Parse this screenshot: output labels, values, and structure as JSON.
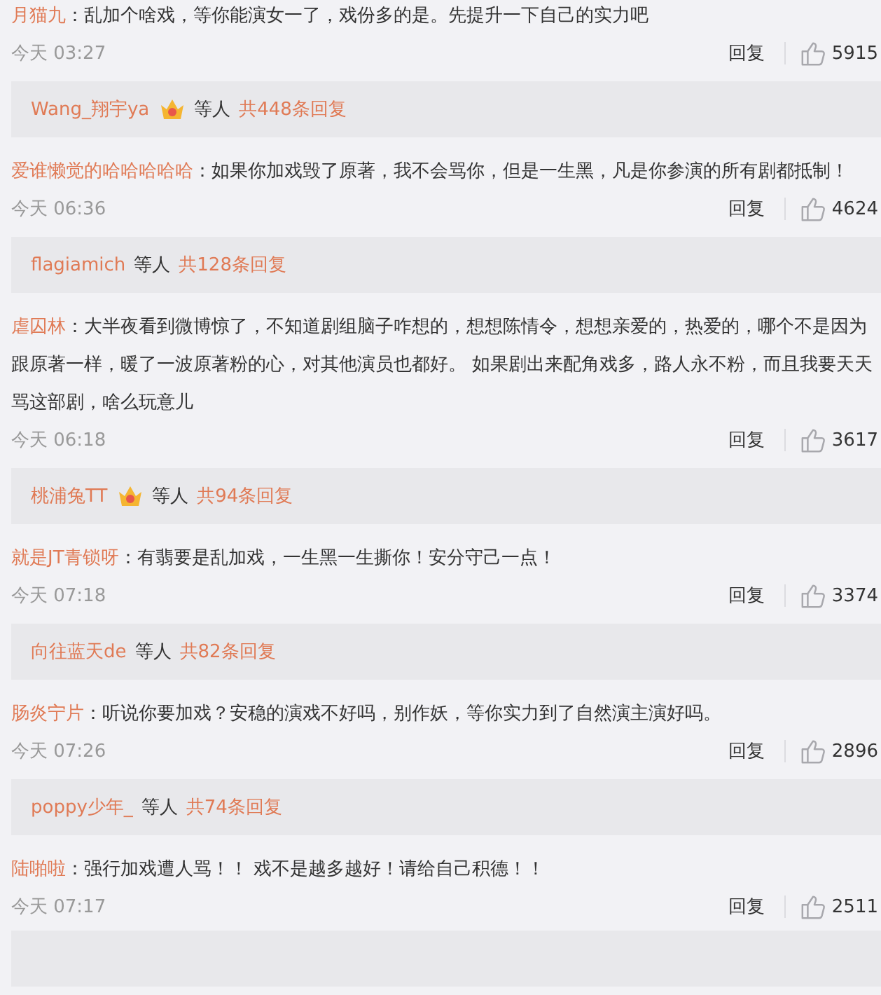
{
  "comments": [
    {
      "user": "月猫九",
      "text": "：乱加个啥戏，等你能演女一了，戏份多的是。先提升一下自己的实力吧",
      "time": "今天 03:27",
      "reply_label": "回复",
      "likes": "5915",
      "replies": {
        "user": "Wang_翔宇ya",
        "badge": true,
        "others": "等人",
        "count": "共448条回复"
      }
    },
    {
      "user": "爱谁懒觉的哈哈哈哈哈",
      "text": "：如果你加戏毁了原著，我不会骂你，但是一生黑，凡是你参演的所有剧都抵制！",
      "time": "今天 06:36",
      "reply_label": "回复",
      "likes": "4624",
      "replies": {
        "user": "flagiamich",
        "badge": false,
        "others": "等人",
        "count": "共128条回复"
      }
    },
    {
      "user": "虐囚林",
      "text": "：大半夜看到微博惊了，不知道剧组脑子咋想的，想想陈情令，想想亲爱的，热爱的，哪个不是因为跟原著一样，暖了一波原著粉的心，对其他演员也都好。 如果剧出来配角戏多，路人永不粉，而且我要天天骂这部剧，啥么玩意儿",
      "time": "今天 06:18",
      "reply_label": "回复",
      "likes": "3617",
      "replies": {
        "user": "桃浦兔TT",
        "badge": true,
        "others": "等人",
        "count": "共94条回复"
      }
    },
    {
      "user": "就是JT青锁呀",
      "text": "：有翡要是乱加戏，一生黑一生撕你！安分守己一点！",
      "time": "今天 07:18",
      "reply_label": "回复",
      "likes": "3374",
      "replies": {
        "user": "向往蓝天de",
        "badge": false,
        "others": "等人",
        "count": "共82条回复"
      }
    },
    {
      "user": "肠炎宁片",
      "text": "：听说你要加戏？安稳的演戏不好吗，别作妖，等你实力到了自然演主演好吗。",
      "time": "今天 07:26",
      "reply_label": "回复",
      "likes": "2896",
      "replies": {
        "user": "poppy少年_",
        "badge": false,
        "others": "等人",
        "count": "共74条回复"
      }
    },
    {
      "user": "陆啪啦",
      "text": "：强行加戏遭人骂！！ 戏不是越多越好！请给自己积德！！",
      "time": "今天 07:17",
      "reply_label": "回复",
      "likes": "2511"
    }
  ],
  "more_below": true
}
